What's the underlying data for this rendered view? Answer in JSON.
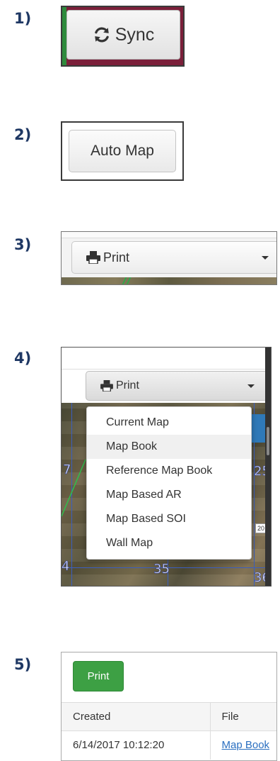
{
  "steps": {
    "s1": "1)",
    "s2": "2)",
    "s3": "3)",
    "s4": "4)",
    "s5": "5)"
  },
  "sync": {
    "label": "Sync",
    "icon": "refresh-icon"
  },
  "auto_map": {
    "label": "Auto Map"
  },
  "print_dropdown": {
    "label": "Print",
    "icon": "printer-icon"
  },
  "print_menu": {
    "label": "Print",
    "items": [
      "Current Map",
      "Map Book",
      "Reference Map Book",
      "Map Based AR",
      "Map Based SOI",
      "Wall Map"
    ],
    "highlighted": "Map Book",
    "map_labels": [
      "7",
      "25",
      "4",
      "35",
      "36"
    ],
    "tag": "20"
  },
  "print_table": {
    "button_label": "Print",
    "columns": [
      "Created",
      "File"
    ],
    "rows": [
      {
        "created": "6/14/2017 10:12:20",
        "file": "Map Book"
      }
    ]
  },
  "colors": {
    "step_label": "#1f3864",
    "print_green": "#3da044",
    "link_blue": "#2a6fc0",
    "map_grid": "#3b5fc0"
  }
}
